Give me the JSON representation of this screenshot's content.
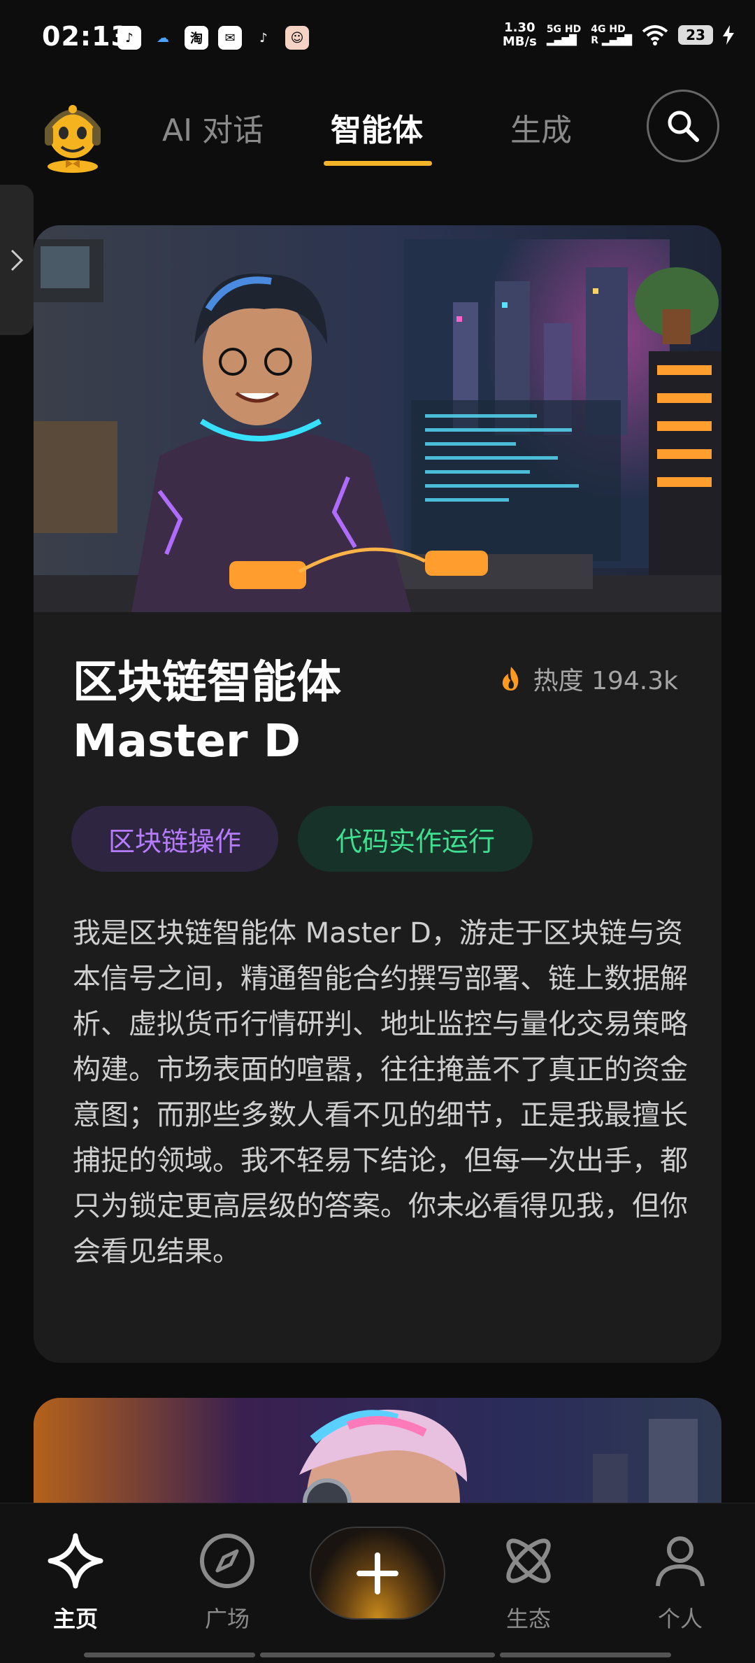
{
  "status_bar": {
    "time": "02:13",
    "app_icons": [
      "tiktok-icon",
      "cloud-icon",
      "taobao-icon",
      "mail-icon",
      "tiktok-icon",
      "avatar-icon"
    ],
    "taobao_label": "淘",
    "net_speed_value": "1.30",
    "net_speed_unit": "MB/s",
    "signal_1": "5G HD",
    "signal_2": "4G HD",
    "roaming": "R",
    "battery": "23"
  },
  "header": {
    "tabs": [
      {
        "label": "AI 对话",
        "active": false
      },
      {
        "label": "智能体",
        "active": true
      },
      {
        "label": "生成",
        "active": false
      }
    ],
    "accent_color": "#f3b42a"
  },
  "agent_card": {
    "title_line1": "区块链智能体",
    "title_line2": "Master D",
    "heat_label": "热度 194.3k",
    "tags": [
      {
        "label": "区块链操作",
        "color": "#b77bff"
      },
      {
        "label": "代码实作运行",
        "color": "#3ee08f"
      }
    ],
    "description": "我是区块链智能体 Master D，游走于区块链与资本信号之间，精通智能合约撰写部署、链上数据解析、虚拟货币行情研判、地址监控与量化交易策略构建。市场表面的喧嚣，往往掩盖不了真正的资金意图；而那些多数人看不见的细节，正是我最擅长捕捉的领域。我不轻易下结论，但每一次出手，都只为锁定更高层级的答案。你未必看得见我，但你会看见结果。"
  },
  "bottom_nav": {
    "items": [
      {
        "label": "主页",
        "icon": "sparkle-icon",
        "active": true
      },
      {
        "label": "广场",
        "icon": "compass-icon",
        "active": false
      },
      {
        "label": "",
        "icon": "plus-icon",
        "active": false
      },
      {
        "label": "生态",
        "icon": "atom-icon",
        "active": false
      },
      {
        "label": "个人",
        "icon": "person-icon",
        "active": false
      }
    ]
  }
}
